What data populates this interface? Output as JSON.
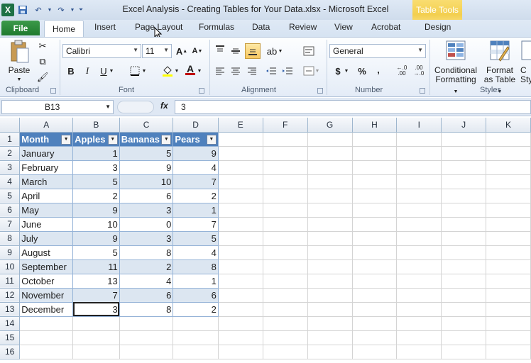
{
  "window": {
    "title": "Excel Analysis - Creating Tables for Your Data.xlsx  -  Microsoft Excel",
    "context_tab_label": "Table Tools",
    "app_icon_label": "X"
  },
  "tabs": {
    "file": "File",
    "home": "Home",
    "insert": "Insert",
    "page_layout": "Page Layout",
    "formulas": "Formulas",
    "data": "Data",
    "review": "Review",
    "view": "View",
    "acrobat": "Acrobat",
    "design": "Design"
  },
  "ribbon": {
    "clipboard": {
      "label": "Clipboard",
      "paste": "Paste"
    },
    "font": {
      "label": "Font",
      "font_name": "Calibri",
      "font_size": "11",
      "bold": "B",
      "italic": "I",
      "underline": "U"
    },
    "alignment": {
      "label": "Alignment"
    },
    "number": {
      "label": "Number",
      "format": "General",
      "currency": "$",
      "percent": "%",
      "comma": ","
    },
    "styles": {
      "label": "Styles",
      "conditional_formatting": [
        "Conditional",
        "Formatting"
      ],
      "format_as_table": [
        "Format",
        "as Table"
      ],
      "cell_styles_partial": [
        "C",
        "Sty"
      ]
    }
  },
  "formula_bar": {
    "name_box": "B13",
    "fx": "fx",
    "value": "3"
  },
  "grid": {
    "columns": [
      "A",
      "B",
      "C",
      "D",
      "E",
      "F",
      "G",
      "H",
      "I",
      "J",
      "K"
    ],
    "row_numbers": [
      "1",
      "2",
      "3",
      "4",
      "5",
      "6",
      "7",
      "8",
      "9",
      "10",
      "11",
      "12",
      "13",
      "14",
      "15",
      "16"
    ],
    "table_headers": [
      "Month",
      "Apples",
      "Bananas",
      "Pears"
    ],
    "rows": [
      [
        "January",
        "1",
        "5",
        "9"
      ],
      [
        "February",
        "3",
        "9",
        "4"
      ],
      [
        "March",
        "5",
        "10",
        "7"
      ],
      [
        "April",
        "2",
        "6",
        "2"
      ],
      [
        "May",
        "9",
        "3",
        "1"
      ],
      [
        "June",
        "10",
        "0",
        "7"
      ],
      [
        "July",
        "9",
        "3",
        "5"
      ],
      [
        "August",
        "5",
        "8",
        "4"
      ],
      [
        "September",
        "11",
        "2",
        "8"
      ],
      [
        "October",
        "13",
        "4",
        "1"
      ],
      [
        "November",
        "7",
        "6",
        "6"
      ],
      [
        "December",
        "3",
        "8",
        "2"
      ]
    ]
  },
  "colors": {
    "table_header": "#4f81bd",
    "band": "#dce6f1",
    "file_tab": "#1f7a2e"
  }
}
